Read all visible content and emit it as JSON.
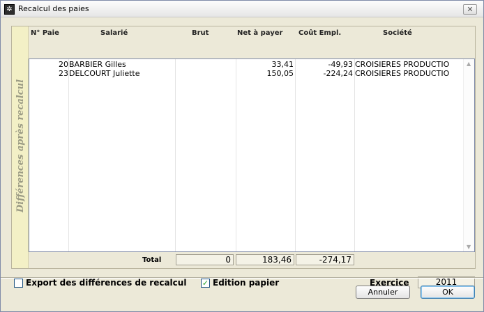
{
  "window": {
    "title": "Recalcul des paies"
  },
  "group": {
    "label": "Différences après recalcul"
  },
  "columns": [
    {
      "label": "N° Paie"
    },
    {
      "label": "Salarié"
    },
    {
      "label": "Brut"
    },
    {
      "label": "Net à payer"
    },
    {
      "label": "Coût Empl."
    },
    {
      "label": "Société"
    }
  ],
  "rows": [
    {
      "num": "20",
      "salarie": "BARBIER Gilles",
      "brut": "",
      "net": "33,41",
      "cout": "-49,93",
      "societe": "CROISIERES PRODUCTIO"
    },
    {
      "num": "23",
      "salarie": "DELCOURT Juliette",
      "brut": "",
      "net": "150,05",
      "cout": "-224,24",
      "societe": "CROISIERES PRODUCTIO"
    }
  ],
  "totals": {
    "label": "Total",
    "brut": "0",
    "net": "183,46",
    "cout": "-274,17"
  },
  "options": {
    "export": {
      "label": "Export des différences de recalcul",
      "checked": false
    },
    "edition": {
      "label": "Edition papier",
      "checked": true
    }
  },
  "exercice": {
    "label": "Exercice",
    "value": "2011"
  },
  "buttons": {
    "cancel": "Annuler",
    "ok": "OK"
  },
  "icons": {
    "check": "✓",
    "close": "✕",
    "scroll_up": "▲",
    "scroll_down": "▼",
    "app": "✲"
  }
}
